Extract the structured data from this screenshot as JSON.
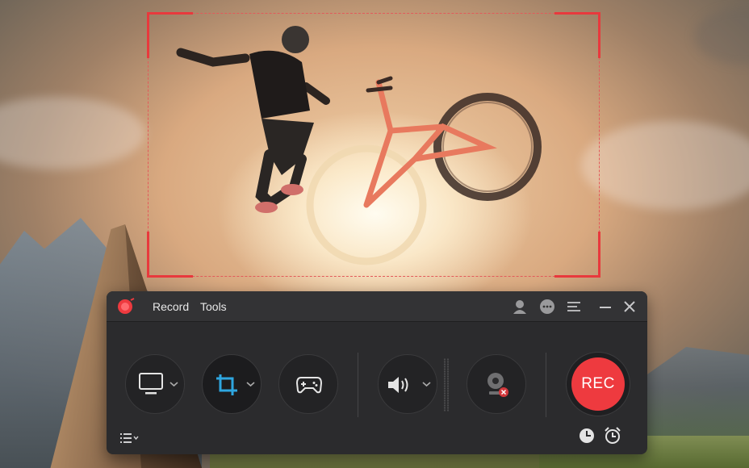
{
  "app": {
    "logo_icon": "recorder-logo-icon",
    "menu": [
      {
        "label": "Record"
      },
      {
        "label": "Tools"
      }
    ],
    "title_icons": [
      "account-icon",
      "chat-icon",
      "menu-icon",
      "minimize-icon",
      "close-icon"
    ]
  },
  "controls": {
    "screen": {
      "icon": "monitor-icon",
      "has_dropdown": true
    },
    "region": {
      "icon": "crop-icon",
      "has_dropdown": true
    },
    "game": {
      "icon": "gamepad-icon"
    },
    "audio": {
      "icon": "speaker-icon",
      "has_dropdown": true
    },
    "webcam": {
      "icon": "webcam-disabled-icon"
    },
    "rec": {
      "label": "REC"
    },
    "list_icon": "list-icon",
    "schedule_icon": "clock-icon",
    "alarm_icon": "alarm-icon"
  },
  "colors": {
    "accent": "#ee3a3f",
    "crop_accent": "#2ea6e0",
    "window_bg": "#2b2b2d",
    "capture_border": "#e8393d"
  }
}
